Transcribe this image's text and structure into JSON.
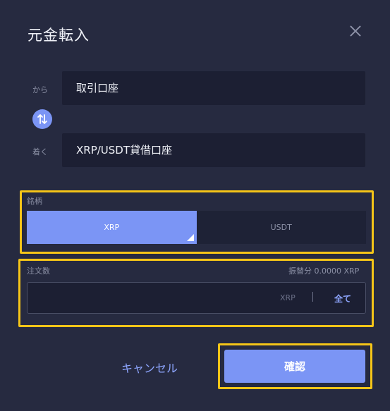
{
  "dialog": {
    "title": "元金転入",
    "close_icon": "close-icon"
  },
  "transfer": {
    "from_label": "から",
    "from_value": "取引口座",
    "swap_icon": "swap-vertical-icon",
    "to_label": "着く",
    "to_value": "XRP/USDT貸借口座"
  },
  "currency": {
    "label": "銘柄",
    "options": [
      "XRP",
      "USDT"
    ],
    "selected": "XRP"
  },
  "quantity": {
    "label": "注文数",
    "transferable": "振替分 0.0000 XRP",
    "value": "",
    "unit": "XRP",
    "all_label": "全て"
  },
  "actions": {
    "cancel_label": "キャンセル",
    "confirm_label": "確認"
  },
  "colors": {
    "accent": "#7b95f5",
    "highlight": "#f5c518",
    "background": "#262a40"
  }
}
